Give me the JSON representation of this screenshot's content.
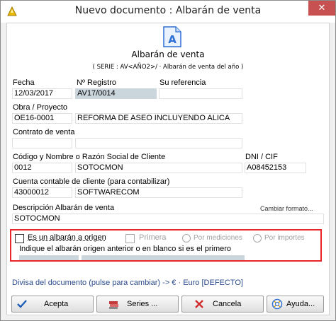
{
  "window": {
    "title": "Nuevo documento : Albarán de venta",
    "close_glyph": "✕"
  },
  "doc": {
    "icon_letter": "A",
    "title": "Albarán de venta",
    "subtitle": "( SERIE : AV<AÑO2>/ · Albarán de venta del año )"
  },
  "fields": {
    "fecha": {
      "label": "Fecha",
      "value": "12/03/2017"
    },
    "registro": {
      "label": "Nº Registro",
      "value": "AV17/0014"
    },
    "su_referencia": {
      "label": "Su referencia",
      "value": ""
    },
    "obra": {
      "label": "Obra / Proyecto",
      "code": "OE16-0001",
      "name": "REFORMA DE ASEO INCLUYENDO ALICA"
    },
    "contrato": {
      "label": "Contrato de venta",
      "code": "",
      "name": ""
    },
    "cliente": {
      "label": "Código y Nombre o Razón Social de Cliente",
      "code": "0012",
      "name": "SOTOCMON"
    },
    "dni": {
      "label": "DNI / CIF",
      "value": "A08452153"
    },
    "cuenta": {
      "label": "Cuenta contable de cliente (para contabilizar)",
      "code": "43000012",
      "name": "SOFTWARECOM"
    },
    "descripcion": {
      "label": "Descripción Albarán de venta",
      "value": "SOTOCMON",
      "change_link": "Cambiar formato..."
    }
  },
  "origin": {
    "checkbox_label": "Es un albarán a origen",
    "primera_label": "Primera",
    "radio_mediciones": "Por mediciones",
    "radio_importes": "Por importes",
    "hint": "Indique el albarán origen anterior o en blanco si es el primero",
    "code": "",
    "name": ""
  },
  "divisa": "Divisa del documento (pulse para cambiar) -> € · Euro [DEFECTO]",
  "buttons": {
    "acepta": "Acepta",
    "series": "Series ...",
    "cancela": "Cancela",
    "ayuda": "Ayuda..."
  },
  "colors": {
    "accent_blue": "#2e6fd3",
    "highlight_red": "#e8262a",
    "close_red": "#c75050",
    "gray_field": "#cbd5dc"
  }
}
